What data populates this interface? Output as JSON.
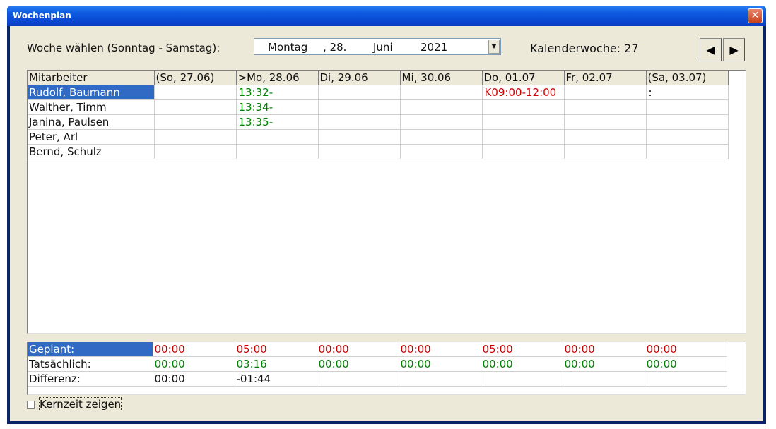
{
  "window": {
    "title": "Wochenplan",
    "close_glyph": "✕"
  },
  "week_select": {
    "label": "Woche wählen (Sonntag - Samstag):",
    "weekday": "Montag",
    "day": ", 28.",
    "month": "Juni",
    "year": "2021",
    "dropdown_glyph": "▼"
  },
  "calendar_week": {
    "label": "Kalenderwoche: 27"
  },
  "nav": {
    "prev_glyph": "◀",
    "next_glyph": "▶"
  },
  "grid": {
    "columns": [
      "Mitarbeiter",
      "(So, 27.06)",
      ">Mo, 28.06",
      "Di, 29.06",
      "Mi, 30.06",
      "Do, 01.07",
      "Fr, 02.07",
      "(Sa, 03.07)"
    ],
    "rows": [
      {
        "name": "Rudolf, Baumann",
        "cells": [
          "",
          "13:32-",
          "",
          "",
          "K09:00-12:00",
          "",
          ":"
        ]
      },
      {
        "name": "Walther, Timm",
        "cells": [
          "",
          "13:34-",
          "",
          "",
          "",
          "",
          ""
        ]
      },
      {
        "name": "Janina, Paulsen",
        "cells": [
          "",
          "13:35-",
          "",
          "",
          "",
          "",
          ""
        ]
      },
      {
        "name": "Peter, Arl",
        "cells": [
          "",
          "",
          "",
          "",
          "",
          "",
          ""
        ]
      },
      {
        "name": "Bernd, Schulz",
        "cells": [
          "",
          "",
          "",
          "",
          "",
          "",
          ""
        ]
      }
    ]
  },
  "summary": {
    "rows": [
      {
        "label": "Geplant:",
        "values": [
          "00:00",
          "05:00",
          "00:00",
          "00:00",
          "05:00",
          "00:00",
          "00:00"
        ]
      },
      {
        "label": "Tatsächlich:",
        "values": [
          "00:00",
          "03:16",
          "00:00",
          "00:00",
          "00:00",
          "00:00",
          "00:00"
        ]
      },
      {
        "label": "Differenz:",
        "values": [
          "00:00",
          "-01:44",
          "",
          "",
          "",
          "",
          ""
        ]
      }
    ]
  },
  "checkbox": {
    "label": "Kernzeit zeigen",
    "checked": false
  },
  "colors": {
    "selection": "#316AC5",
    "planned": "#CC0000",
    "actual": "#008000"
  }
}
